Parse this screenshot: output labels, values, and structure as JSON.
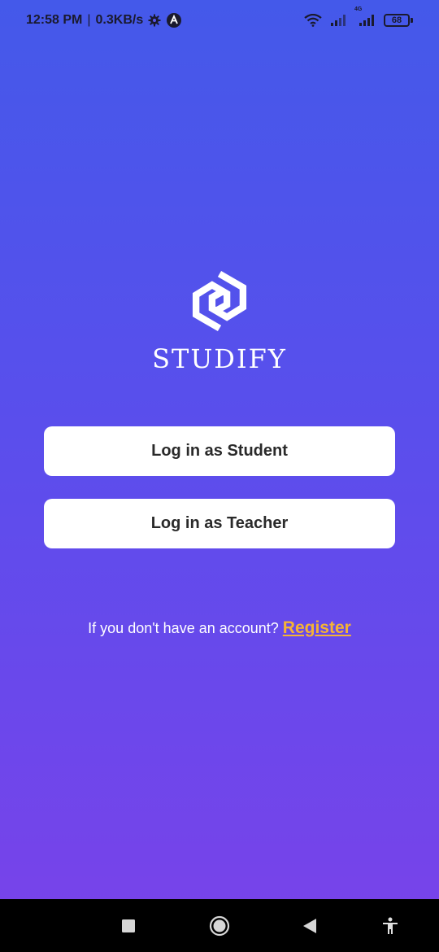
{
  "status_bar": {
    "time": "12:58 PM",
    "separator": "|",
    "speed": "0.3KB/s",
    "battery": "68",
    "network_label": "4G",
    "icons": [
      "gear-icon",
      "app-a-icon",
      "wifi-icon",
      "signal-icon",
      "signal-4g-icon",
      "battery-icon"
    ]
  },
  "brand": {
    "name": "STUDIFY",
    "logo_icon": "studify-logo-icon"
  },
  "actions": {
    "student_label": "Log in as Student",
    "teacher_label": "Log in as Teacher"
  },
  "register": {
    "prompt": "If you don't have an account?",
    "link_label": "Register"
  },
  "nav_bar": {
    "icons": [
      "recent-apps-icon",
      "home-icon",
      "back-icon",
      "accessibility-icon"
    ]
  },
  "colors": {
    "gradient_top": "#4459ea",
    "gradient_bottom": "#7a42ea",
    "button_bg": "#ffffff",
    "register_link": "#f5b335"
  }
}
